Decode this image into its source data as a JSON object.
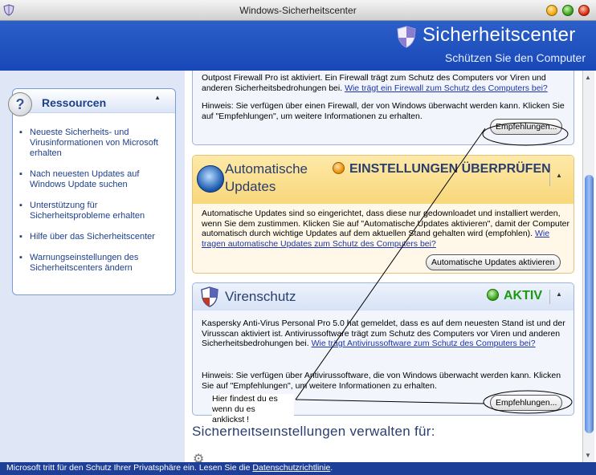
{
  "window": {
    "title": "Windows-Sicherheitscenter"
  },
  "header": {
    "title": "Sicherheitscenter",
    "subtitle": "Schützen Sie den Computer",
    "shield_icon": "shield-icon"
  },
  "sidebar": {
    "title": "Ressourcen",
    "items": [
      {
        "label": "Neueste Sicherheits- und Virusinformationen von Microsoft erhalten"
      },
      {
        "label": "Nach neuesten Updates auf Windows Update suchen"
      },
      {
        "label": "Unterstützung für Sicherheitsprobleme erhalten"
      },
      {
        "label": "Hilfe über das Sicherheitscenter"
      },
      {
        "label": "Warnungseinstellungen des Sicherheitscenters ändern"
      }
    ]
  },
  "firewall": {
    "text": "Outpost Firewall Pro ist aktiviert. Ein Firewall trägt zum Schutz des Computers vor Viren und anderen Sicherheitsbedrohungen bei.",
    "link": "Wie trägt ein Firewall zum Schutz des Computers bei?",
    "hint": "Hinweis: Sie verfügen über einen Firewall, der von Windows überwacht werden kann. Klicken Sie auf \"Empfehlungen\", um weitere Informationen zu erhalten.",
    "button": "Empfehlungen..."
  },
  "updates": {
    "title": "Automatische Updates",
    "status": "EINSTELLUNGEN ÜBERPRÜFEN",
    "status_color": "#e88a00",
    "text": "Automatische Updates sind so eingerichtet, dass diese nur gedownloadet und installiert werden, wenn Sie dem zustimmen. Klicken Sie auf \"Automatische Updates aktivieren\", damit der Computer automatisch durch wichtige Updates auf dem aktuellen Stand gehalten wird (empfohlen).",
    "link": "Wie tragen automatische Updates zum Schutz des Computers bei?",
    "button": "Automatische Updates aktivieren"
  },
  "antivirus": {
    "title": "Virenschutz",
    "status": "AKTIV",
    "status_color": "#1a9a10",
    "text": "Kaspersky Anti-Virus Personal Pro 5.0 hat gemeldet, dass es auf dem neuesten Stand ist und der Virusscan aktiviert ist. Antivirussoftware trägt zum Schutz des Computers vor Viren und anderen Sicherheitsbedrohungen bei.",
    "link": "Wie trägt Antivirussoftware zum Schutz des Computers bei?",
    "hint": "Hinweis: Sie verfügen über Antivirussoftware, die von Windows überwacht werden kann. Klicken Sie auf \"Empfehlungen\", um weitere Informationen zu erhalten.",
    "button": "Empfehlungen..."
  },
  "manage": {
    "title": "Sicherheitseinstellungen verwalten für:"
  },
  "annotation": {
    "note_line1": "Hier findest du es",
    "note_line2": "wenn du es",
    "note_line3": "anklickst !"
  },
  "statusbar": {
    "text": "Microsoft tritt für den Schutz Ihrer Privatsphäre ein. Lesen Sie die",
    "link": "Datenschutzrichtlinie",
    "suffix": "."
  }
}
